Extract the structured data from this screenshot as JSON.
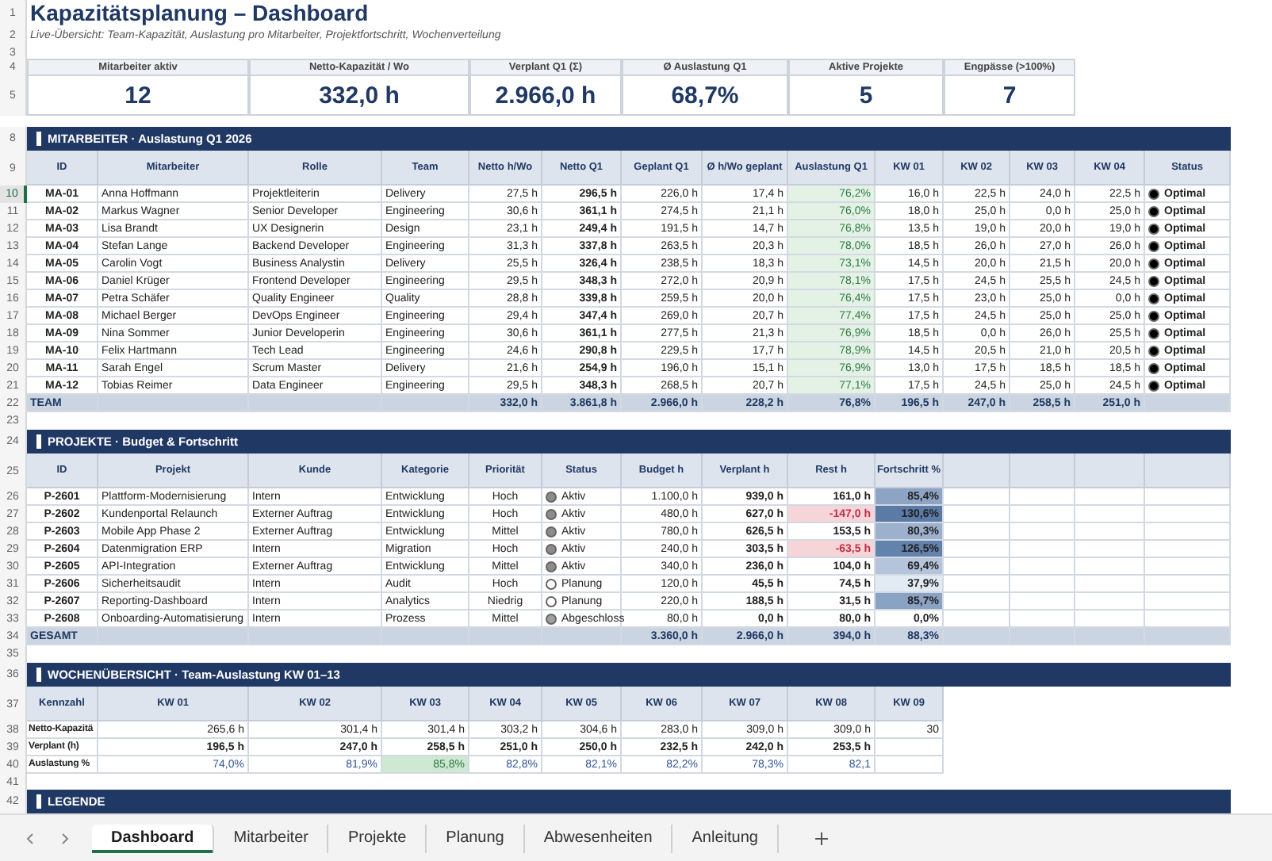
{
  "title": "Kapazitätsplanung – Dashboard",
  "subtitle": "Live-Übersicht: Team-Kapazität, Auslastung pro Mitarbeiter, Projektfortschritt, Wochenverteilung",
  "row_numbers": [
    {
      "label": "1",
      "selected": false
    },
    {
      "label": "2",
      "selected": false
    },
    {
      "label": "3",
      "selected": false
    },
    {
      "label": "4",
      "selected": false
    },
    {
      "label": "5",
      "selected": false
    },
    {
      "label": "8",
      "selected": false
    },
    {
      "label": "9",
      "selected": false
    },
    {
      "label": "10",
      "selected": true
    },
    {
      "label": "11",
      "selected": false
    },
    {
      "label": "12",
      "selected": false
    },
    {
      "label": "13",
      "selected": false
    },
    {
      "label": "14",
      "selected": false
    },
    {
      "label": "15",
      "selected": false
    },
    {
      "label": "16",
      "selected": false
    },
    {
      "label": "17",
      "selected": false
    },
    {
      "label": "18",
      "selected": false
    },
    {
      "label": "19",
      "selected": false
    },
    {
      "label": "20",
      "selected": false
    },
    {
      "label": "21",
      "selected": false
    },
    {
      "label": "22",
      "selected": false
    },
    {
      "label": "23",
      "selected": false
    },
    {
      "label": "24",
      "selected": false
    },
    {
      "label": "25",
      "selected": false
    },
    {
      "label": "26",
      "selected": false
    },
    {
      "label": "27",
      "selected": false
    },
    {
      "label": "28",
      "selected": false
    },
    {
      "label": "29",
      "selected": false
    },
    {
      "label": "30",
      "selected": false
    },
    {
      "label": "31",
      "selected": false
    },
    {
      "label": "32",
      "selected": false
    },
    {
      "label": "33",
      "selected": false
    },
    {
      "label": "34",
      "selected": false
    },
    {
      "label": "35",
      "selected": false
    },
    {
      "label": "36",
      "selected": false
    },
    {
      "label": "37",
      "selected": false
    },
    {
      "label": "38",
      "selected": false
    },
    {
      "label": "39",
      "selected": false
    },
    {
      "label": "40",
      "selected": false
    },
    {
      "label": "41",
      "selected": false
    },
    {
      "label": "42",
      "selected": false
    }
  ],
  "kpis": [
    {
      "label": "Mitarbeiter aktiv",
      "value": "12"
    },
    {
      "label": "Netto-Kapazität / Wo",
      "value": "332,0 h"
    },
    {
      "label": "Verplant Q1 (Σ)",
      "value": "2.966,0 h"
    },
    {
      "label": "Ø Auslastung Q1",
      "value": "68,7%"
    },
    {
      "label": "Aktive Projekte",
      "value": "5"
    },
    {
      "label": "Engpässe (>100%)",
      "value": "7"
    }
  ],
  "employees": {
    "title": "MITARBEITER · Auslastung Q1 2026",
    "columns": [
      "ID",
      "Mitarbeiter",
      "Rolle",
      "Team",
      "Netto h/Wo",
      "Netto Q1",
      "Geplant Q1",
      "Ø h/Wo geplant",
      "Auslastung Q1",
      "KW 01",
      "KW 02",
      "KW 03",
      "KW 04",
      "Status"
    ],
    "rows": [
      {
        "cells": [
          "MA-01",
          "Anna Hoffmann",
          "Projektleiterin",
          "Delivery",
          "27,5 h",
          "296,5 h",
          "226,0 h",
          "17,4 h",
          "76,2%",
          "16,0 h",
          "22,5 h",
          "24,0 h",
          "22,5 h"
        ],
        "status": {
          "label": "Optimal",
          "color": "#000000"
        }
      },
      {
        "cells": [
          "MA-02",
          "Markus Wagner",
          "Senior Developer",
          "Engineering",
          "30,6 h",
          "361,1 h",
          "274,5 h",
          "21,1 h",
          "76,0%",
          "18,0 h",
          "25,0 h",
          "0,0 h",
          "25,0 h"
        ],
        "status": {
          "label": "Optimal",
          "color": "#000000"
        }
      },
      {
        "cells": [
          "MA-03",
          "Lisa Brandt",
          "UX Designerin",
          "Design",
          "23,1 h",
          "249,4 h",
          "191,5 h",
          "14,7 h",
          "76,8%",
          "13,5 h",
          "19,0 h",
          "20,0 h",
          "19,0 h"
        ],
        "status": {
          "label": "Optimal",
          "color": "#000000"
        }
      },
      {
        "cells": [
          "MA-04",
          "Stefan Lange",
          "Backend Developer",
          "Engineering",
          "31,3 h",
          "337,8 h",
          "263,5 h",
          "20,3 h",
          "78,0%",
          "18,5 h",
          "26,0 h",
          "27,0 h",
          "26,0 h"
        ],
        "status": {
          "label": "Optimal",
          "color": "#000000"
        }
      },
      {
        "cells": [
          "MA-05",
          "Carolin Vogt",
          "Business Analystin",
          "Delivery",
          "25,5 h",
          "326,4 h",
          "238,5 h",
          "18,3 h",
          "73,1%",
          "14,5 h",
          "20,0 h",
          "21,5 h",
          "20,0 h"
        ],
        "status": {
          "label": "Optimal",
          "color": "#000000"
        }
      },
      {
        "cells": [
          "MA-06",
          "Daniel Krüger",
          "Frontend Developer",
          "Engineering",
          "29,5 h",
          "348,3 h",
          "272,0 h",
          "20,9 h",
          "78,1%",
          "17,5 h",
          "24,5 h",
          "25,5 h",
          "24,5 h"
        ],
        "status": {
          "label": "Optimal",
          "color": "#000000"
        }
      },
      {
        "cells": [
          "MA-07",
          "Petra Schäfer",
          "Quality Engineer",
          "Quality",
          "28,8 h",
          "339,8 h",
          "259,5 h",
          "20,0 h",
          "76,4%",
          "17,5 h",
          "23,0 h",
          "25,0 h",
          "0,0 h"
        ],
        "status": {
          "label": "Optimal",
          "color": "#000000"
        }
      },
      {
        "cells": [
          "MA-08",
          "Michael Berger",
          "DevOps Engineer",
          "Engineering",
          "29,4 h",
          "347,4 h",
          "269,0 h",
          "20,7 h",
          "77,4%",
          "17,5 h",
          "24,5 h",
          "25,0 h",
          "25,0 h"
        ],
        "status": {
          "label": "Optimal",
          "color": "#000000"
        }
      },
      {
        "cells": [
          "MA-09",
          "Nina Sommer",
          "Junior Developerin",
          "Engineering",
          "30,6 h",
          "361,1 h",
          "277,5 h",
          "21,3 h",
          "76,9%",
          "18,5 h",
          "0,0 h",
          "26,0 h",
          "25,5 h"
        ],
        "status": {
          "label": "Optimal",
          "color": "#000000"
        }
      },
      {
        "cells": [
          "MA-10",
          "Felix Hartmann",
          "Tech Lead",
          "Engineering",
          "24,6 h",
          "290,8 h",
          "229,5 h",
          "17,7 h",
          "78,9%",
          "14,5 h",
          "20,5 h",
          "21,0 h",
          "20,5 h"
        ],
        "status": {
          "label": "Optimal",
          "color": "#000000"
        }
      },
      {
        "cells": [
          "MA-11",
          "Sarah Engel",
          "Scrum Master",
          "Delivery",
          "21,6 h",
          "254,9 h",
          "196,0 h",
          "15,1 h",
          "76,9%",
          "13,0 h",
          "17,5 h",
          "18,5 h",
          "18,5 h"
        ],
        "status": {
          "label": "Optimal",
          "color": "#000000"
        }
      },
      {
        "cells": [
          "MA-12",
          "Tobias Reimer",
          "Data Engineer",
          "Engineering",
          "29,5 h",
          "348,3 h",
          "268,5 h",
          "20,7 h",
          "77,1%",
          "17,5 h",
          "24,5 h",
          "25,0 h",
          "24,5 h"
        ],
        "status": {
          "label": "Optimal",
          "color": "#000000"
        }
      }
    ],
    "total": {
      "label": "TEAM",
      "values": [
        "332,0 h",
        "3.861,8 h",
        "2.966,0 h",
        "228,2 h",
        "76,8%",
        "196,5 h",
        "247,0 h",
        "258,5 h",
        "251,0 h"
      ]
    }
  },
  "projects": {
    "title": "PROJEKTE · Budget & Fortschritt",
    "columns": [
      "ID",
      "Projekt",
      "Kunde",
      "Kategorie",
      "Priorität",
      "Status",
      "Budget h",
      "Verplant h",
      "Rest h",
      "Fortschritt %"
    ],
    "rows": [
      {
        "cells": [
          "P-2601",
          "Plattform-Modernisierung",
          "Intern",
          "Entwicklung",
          "Hoch"
        ],
        "status": {
          "label": "Aktiv",
          "color": "#8c8c8c"
        },
        "hours": [
          "1.100,0 h",
          "939,0 h"
        ],
        "rest": {
          "text": "161,0 h",
          "over_budget": false
        },
        "progress": {
          "text": "85,4%",
          "color": "#8da4c4"
        }
      },
      {
        "cells": [
          "P-2602",
          "Kundenportal Relaunch",
          "Externer Auftrag",
          "Entwicklung",
          "Hoch"
        ],
        "status": {
          "label": "Aktiv",
          "color": "#8c8c8c"
        },
        "hours": [
          "480,0 h",
          "627,0 h"
        ],
        "rest": {
          "text": "-147,0 h",
          "over_budget": true
        },
        "progress": {
          "text": "130,6%",
          "color": "#5b7aa6"
        }
      },
      {
        "cells": [
          "P-2603",
          "Mobile App Phase 2",
          "Externer Auftrag",
          "Entwicklung",
          "Mittel"
        ],
        "status": {
          "label": "Aktiv",
          "color": "#8c8c8c"
        },
        "hours": [
          "780,0 h",
          "626,5 h"
        ],
        "rest": {
          "text": "153,5 h",
          "over_budget": false
        },
        "progress": {
          "text": "80,3%",
          "color": "#9db1ce"
        }
      },
      {
        "cells": [
          "P-2604",
          "Datenmigration ERP",
          "Intern",
          "Migration",
          "Hoch"
        ],
        "status": {
          "label": "Aktiv",
          "color": "#8c8c8c"
        },
        "hours": [
          "240,0 h",
          "303,5 h"
        ],
        "rest": {
          "text": "-63,5 h",
          "over_budget": true
        },
        "progress": {
          "text": "126,5%",
          "color": "#6382ac"
        }
      },
      {
        "cells": [
          "P-2605",
          "API-Integration",
          "Externer Auftrag",
          "Entwicklung",
          "Mittel"
        ],
        "status": {
          "label": "Aktiv",
          "color": "#8c8c8c"
        },
        "hours": [
          "340,0 h",
          "236,0 h"
        ],
        "rest": {
          "text": "104,0 h",
          "over_budget": false
        },
        "progress": {
          "text": "69,4%",
          "color": "#b4c4da"
        }
      },
      {
        "cells": [
          "P-2606",
          "Sicherheitsaudit",
          "Intern",
          "Audit",
          "Hoch"
        ],
        "status": {
          "label": "Planung",
          "color": "#ffffff"
        },
        "hours": [
          "120,0 h",
          "45,5 h"
        ],
        "rest": {
          "text": "74,5 h",
          "over_budget": false
        },
        "progress": {
          "text": "37,9%",
          "color": "#e2eaf4"
        }
      },
      {
        "cells": [
          "P-2607",
          "Reporting-Dashboard",
          "Intern",
          "Analytics",
          "Niedrig"
        ],
        "status": {
          "label": "Planung",
          "color": "#ffffff"
        },
        "hours": [
          "220,0 h",
          "188,5 h"
        ],
        "rest": {
          "text": "31,5 h",
          "over_budget": false
        },
        "progress": {
          "text": "85,7%",
          "color": "#8aa2c3"
        }
      },
      {
        "cells": [
          "P-2608",
          "Onboarding-Automatisierung",
          "Intern",
          "Prozess",
          "Mittel"
        ],
        "status": {
          "label": "Abgeschloss",
          "color": "#a0a0a0"
        },
        "hours": [
          "80,0 h",
          "0,0 h"
        ],
        "rest": {
          "text": "80,0 h",
          "over_budget": false
        },
        "progress": {
          "text": "0,0%",
          "color": "#ffffff"
        }
      }
    ],
    "total": {
      "label": "GESAMT",
      "values": [
        "3.360,0 h",
        "2.966,0 h",
        "394,0 h",
        "88,3%"
      ]
    }
  },
  "weeks": {
    "title": "WOCHENÜBERSICHT · Team-Auslastung KW 01–13",
    "columns": [
      "Kennzahl",
      "KW 01",
      "KW 02",
      "KW 03",
      "KW 04",
      "KW 05",
      "KW 06",
      "KW 07",
      "KW 08",
      "KW 09"
    ],
    "rows": [
      {
        "kind": "capacity",
        "label": "Netto-Kapazitä",
        "values": [
          {
            "text": "265,6 h",
            "highlight": false
          },
          {
            "text": "301,4 h",
            "highlight": false
          },
          {
            "text": "301,4 h",
            "highlight": false
          },
          {
            "text": "303,2 h",
            "highlight": false
          },
          {
            "text": "304,6 h",
            "highlight": false
          },
          {
            "text": "283,0 h",
            "highlight": false
          },
          {
            "text": "309,0 h",
            "highlight": false
          },
          {
            "text": "309,0 h",
            "highlight": false
          },
          {
            "text": "30",
            "highlight": false
          }
        ]
      },
      {
        "kind": "planned",
        "label": "Verplant (h)",
        "values": [
          {
            "text": "196,5 h",
            "highlight": false
          },
          {
            "text": "247,0 h",
            "highlight": false
          },
          {
            "text": "258,5 h",
            "highlight": false
          },
          {
            "text": "251,0 h",
            "highlight": false
          },
          {
            "text": "250,0 h",
            "highlight": false
          },
          {
            "text": "232,5 h",
            "highlight": false
          },
          {
            "text": "242,0 h",
            "highlight": false
          },
          {
            "text": "253,5 h",
            "highlight": false
          }
        ]
      },
      {
        "kind": "percent",
        "label": "Auslastung %",
        "values": [
          {
            "text": "74,0%",
            "highlight": false
          },
          {
            "text": "81,9%",
            "highlight": false
          },
          {
            "text": "85,8%",
            "highlight": true
          },
          {
            "text": "82,8%",
            "highlight": false
          },
          {
            "text": "82,1%",
            "highlight": false
          },
          {
            "text": "82,2%",
            "highlight": false
          },
          {
            "text": "78,3%",
            "highlight": false
          },
          {
            "text": "82,1",
            "highlight": false
          }
        ]
      }
    ]
  },
  "legend": {
    "title": "LEGENDE"
  },
  "sheet_tabs": [
    {
      "label": "Dashboard",
      "selected": true
    },
    {
      "label": "Mitarbeiter",
      "selected": false
    },
    {
      "label": "Projekte",
      "selected": false
    },
    {
      "label": "Planung",
      "selected": false
    },
    {
      "label": "Abwesenheiten",
      "selected": false
    },
    {
      "label": "Anleitung",
      "selected": false
    }
  ]
}
